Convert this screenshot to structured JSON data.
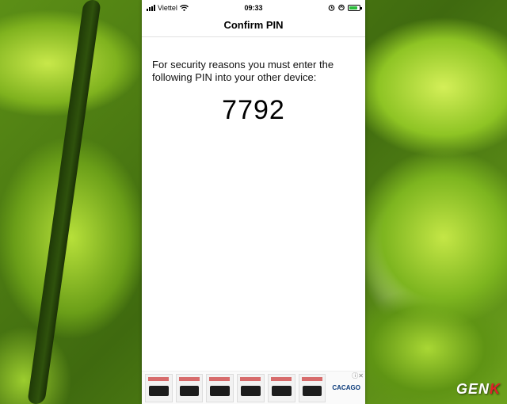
{
  "status_bar": {
    "carrier": "Viettel",
    "time": "09:33",
    "battery_fraction": 0.8,
    "icons": [
      "signal-icon",
      "wifi-icon",
      "alarm-icon",
      "location-icon",
      "battery-icon"
    ]
  },
  "nav": {
    "title": "Confirm PIN"
  },
  "main": {
    "message": "For security reasons you must enter the following PIN into your other device:",
    "pin": "7792"
  },
  "ad": {
    "logo_text": "CACAGO",
    "close_icon": "close-icon",
    "info_icon": "info-icon"
  },
  "watermark": {
    "text_main": "GEN",
    "text_accent": "K"
  },
  "colors": {
    "battery": "#2bbd3b",
    "watermark_accent": "#e0202a"
  }
}
